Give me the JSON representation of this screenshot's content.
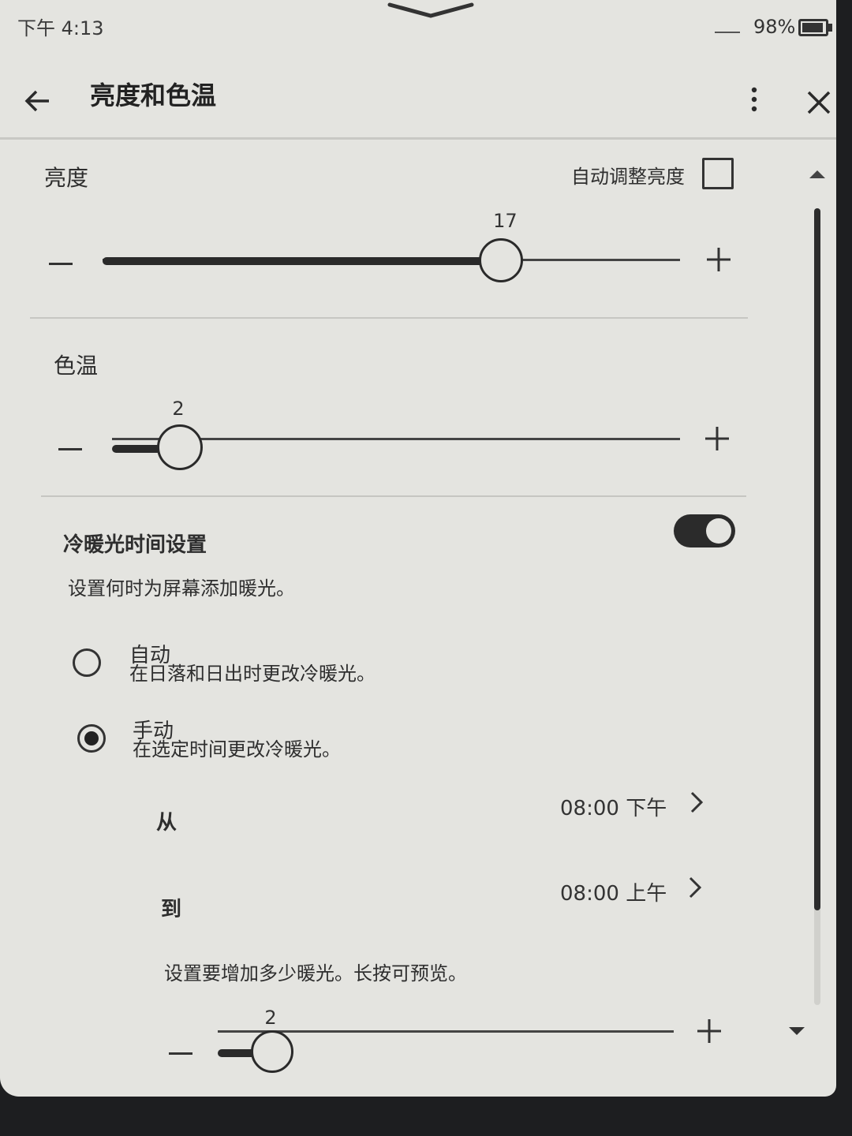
{
  "status_bar": {
    "time": "下午 4:13",
    "battery": "98%"
  },
  "header": {
    "title": "亮度和色温"
  },
  "brightness": {
    "label": "亮度",
    "auto_label": "自动调整亮度",
    "auto_checked": false,
    "value": "17",
    "level": 0.69
  },
  "color_temp": {
    "label": "色温",
    "value": "2",
    "level": 0.12
  },
  "schedule": {
    "title": "冷暖光时间设置",
    "enabled": true,
    "description": "设置何时为屏幕添加暖光。",
    "options": [
      {
        "title": "自动",
        "desc": "在日落和日出时更改冷暖光。",
        "selected": false
      },
      {
        "title": "手动",
        "desc": "在选定时间更改冷暖光。",
        "selected": true
      }
    ],
    "from": {
      "label": "从",
      "value": "08:00 下午"
    },
    "to": {
      "label": "到",
      "value": "08:00 上午"
    },
    "warmth_hint": "设置要增加多少暖光。长按可预览。",
    "warmth_value": "2",
    "warmth_level": 0.12
  }
}
